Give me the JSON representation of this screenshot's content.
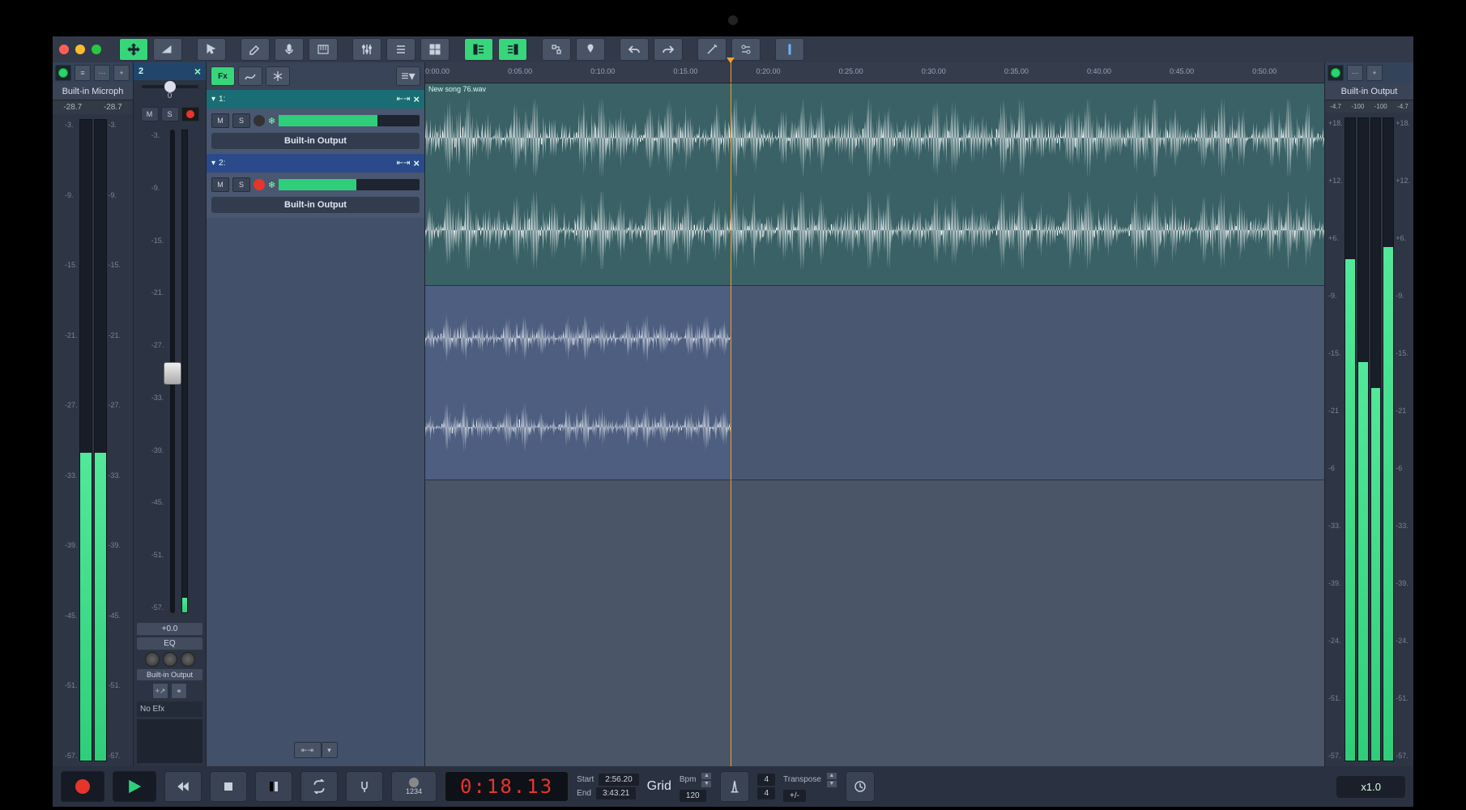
{
  "input_channel": {
    "title": "Built-in Microph",
    "db_left": "-28.7",
    "db_right": "-28.7",
    "meter_fill": 48
  },
  "output_channel": {
    "title": "Built-in Output",
    "db": [
      "-4.7",
      "-100",
      "-100",
      "-4.7"
    ],
    "meter_fill": [
      78,
      62,
      58,
      80
    ]
  },
  "scale_in": [
    "-3.",
    "-9.",
    "-15.",
    "-21.",
    "-27.",
    "-33.",
    "-39.",
    "-45.",
    "-51.",
    "-57."
  ],
  "scale_out": [
    "+18.",
    "+12.",
    "+6.",
    "-9.",
    "-15.",
    "-21",
    "-6",
    "-33.",
    "-39.",
    "-24.",
    "-51.",
    "-57."
  ],
  "channel_strip": {
    "number": "2",
    "pan_value": "0",
    "fader_db": "+0.0",
    "eq_label": "EQ",
    "output": "Built-in Output",
    "nofx": "No Efx"
  },
  "tracks": [
    {
      "num": "1:",
      "output": "Built-in Output",
      "color": "t1",
      "rec": false,
      "vol": 70
    },
    {
      "num": "2:",
      "output": "Built-in Output",
      "color": "t2",
      "rec": true,
      "vol": 55
    }
  ],
  "clip_name": "New song 76.wav",
  "ruler": [
    "0:00.00",
    "0:05.00",
    "0:10.00",
    "0:15.00",
    "0:20.00",
    "0:25.00",
    "0:30.00",
    "0:35.00",
    "0:40.00",
    "0:45.00",
    "0:50.00"
  ],
  "playhead_pct": 34,
  "transport": {
    "time": "0:18.13",
    "start_label": "Start",
    "start": "2:56.20",
    "end_label": "End",
    "end": "3:43.21",
    "grid": "Grid",
    "bpm_label": "Bpm",
    "bpm": "120",
    "metronome": "4",
    "metronome_sig": "4",
    "transpose_label": "Transpose",
    "transpose": "+/-",
    "zoom": "x1.0",
    "counter": "1234"
  },
  "fx_label": "Fx",
  "m": "M",
  "s": "S"
}
